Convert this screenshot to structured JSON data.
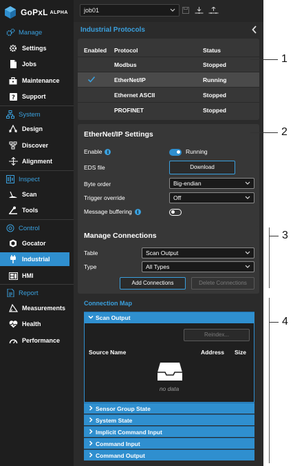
{
  "app": {
    "name": "GoPxL",
    "edition": "ALPHA"
  },
  "topbar": {
    "job_name": "job01"
  },
  "sidebar": {
    "sections": [
      {
        "key": "manage",
        "label": "Manage",
        "icon": "gears-icon",
        "items": [
          {
            "label": "Settings",
            "icon": "gear-icon"
          },
          {
            "label": "Jobs",
            "icon": "file-icon"
          },
          {
            "label": "Maintenance",
            "icon": "toolbox-icon"
          },
          {
            "label": "Support",
            "icon": "help-icon"
          }
        ]
      },
      {
        "key": "system",
        "label": "System",
        "icon": "network-icon",
        "items": [
          {
            "label": "Design",
            "icon": "design-icon"
          },
          {
            "label": "Discover",
            "icon": "discover-icon"
          },
          {
            "label": "Alignment",
            "icon": "alignment-icon"
          }
        ]
      },
      {
        "key": "inspect",
        "label": "Inspect",
        "icon": "inspect-icon",
        "items": [
          {
            "label": "Scan",
            "icon": "scan-icon"
          },
          {
            "label": "Tools",
            "icon": "tools-icon"
          }
        ]
      },
      {
        "key": "control",
        "label": "Control",
        "icon": "control-icon",
        "items": [
          {
            "label": "Gocator",
            "icon": "gocator-icon"
          },
          {
            "label": "Industrial",
            "icon": "plug-icon",
            "active": true
          },
          {
            "label": "HMI",
            "icon": "hmi-icon"
          }
        ]
      },
      {
        "key": "report",
        "label": "Report",
        "icon": "report-icon",
        "items": [
          {
            "label": "Measurements",
            "icon": "measure-icon"
          },
          {
            "label": "Health",
            "icon": "heart-icon"
          },
          {
            "label": "Performance",
            "icon": "gauge-icon"
          }
        ]
      }
    ]
  },
  "main": {
    "title": "Industrial Protocols",
    "protocols": {
      "headers": {
        "enabled": "Enabled",
        "protocol": "Protocol",
        "status": "Status"
      },
      "rows": [
        {
          "protocol": "Modbus",
          "status": "Stopped",
          "enabled": false
        },
        {
          "protocol": "EtherNet/IP",
          "status": "Running",
          "enabled": true
        },
        {
          "protocol": "Ethernet ASCII",
          "status": "Stopped",
          "enabled": false
        },
        {
          "protocol": "PROFINET",
          "status": "Stopped",
          "enabled": false
        }
      ]
    },
    "eip_settings": {
      "title": "EtherNet/IP Settings",
      "enable_label": "Enable",
      "enable_state": "Running",
      "eds_label": "EDS file",
      "download_label": "Download",
      "byte_order_label": "Byte order",
      "byte_order_value": "Big-endian",
      "trigger_label": "Trigger override",
      "trigger_value": "Off",
      "buffering_label": "Message buffering",
      "buffering_on": false
    },
    "connections": {
      "title": "Manage Connections",
      "table_label": "Table",
      "table_value": "Scan Output",
      "type_label": "Type",
      "type_value": "All Types",
      "add_label": "Add Connections",
      "delete_label": "Delete Connections"
    },
    "connection_map": {
      "title": "Connection Map",
      "expanded": {
        "label": "Scan Output",
        "reindex_label": "Reindex...",
        "col_source": "Source Name",
        "col_address": "Address",
        "col_size": "Size",
        "empty_text": "no data"
      },
      "collapsed": [
        "Sensor Group State",
        "System State",
        "Implicit Command Input",
        "Command Input",
        "Command Output"
      ]
    }
  },
  "callouts": [
    "1",
    "2",
    "3",
    "4"
  ],
  "colors": {
    "accent": "#2f8fcf",
    "sidebar_bg": "#1e1e1e",
    "panel_bg": "#2b2b2b",
    "card_bg": "#373737"
  }
}
